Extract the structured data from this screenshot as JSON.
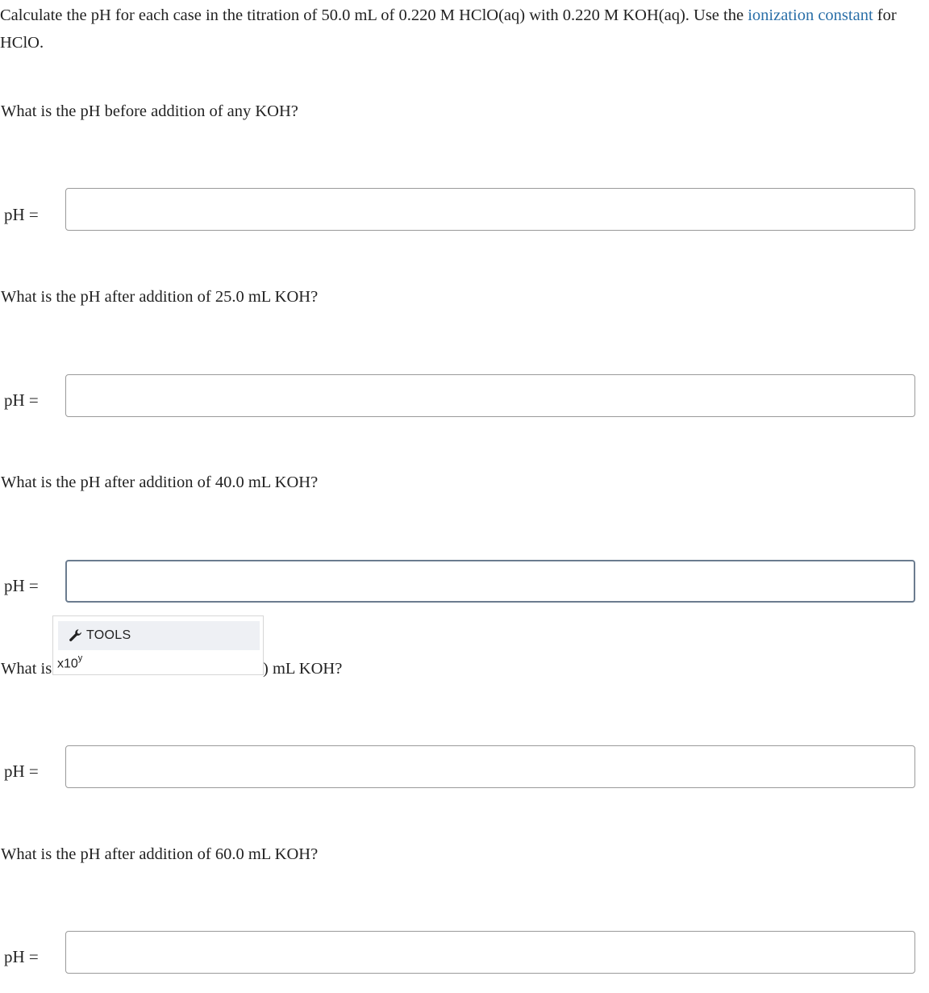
{
  "intro": {
    "text_before_link": "Calculate the pH for each case in the titration of 50.0 mL of 0.220 M HClO(aq) with 0.220 M KOH(aq). Use the ",
    "link_text": "ionization constant",
    "text_after_link": " for HClO."
  },
  "questions": [
    {
      "question": "What is the pH before addition of any KOH?",
      "label": "pH =",
      "value": "",
      "placeholder": ""
    },
    {
      "question": "What is the pH after addition of 25.0 mL KOH?",
      "label": "pH =",
      "value": "",
      "placeholder": ""
    },
    {
      "question": "What is the pH after addition of 40.0 mL KOH?",
      "label": "pH =",
      "value": "",
      "placeholder": ""
    },
    {
      "question_visible_start": "What is",
      "question_visible_end": ") mL KOH?",
      "label": "pH =",
      "value": "",
      "placeholder": ""
    },
    {
      "question": "What is the pH after addition of 60.0 mL KOH?",
      "label": "pH =",
      "value": "",
      "placeholder": ""
    }
  ],
  "tools_popup": {
    "title": "TOOLS",
    "icon": "wrench-icon",
    "sci_notation_base": "x10",
    "sci_notation_exponent": "y"
  },
  "colors": {
    "link": "#2a6fa8",
    "text": "#222222",
    "input_border": "#9a9a9a",
    "focused_input_border": "#6b7c8f",
    "tools_header_bg": "#eef0f4"
  }
}
